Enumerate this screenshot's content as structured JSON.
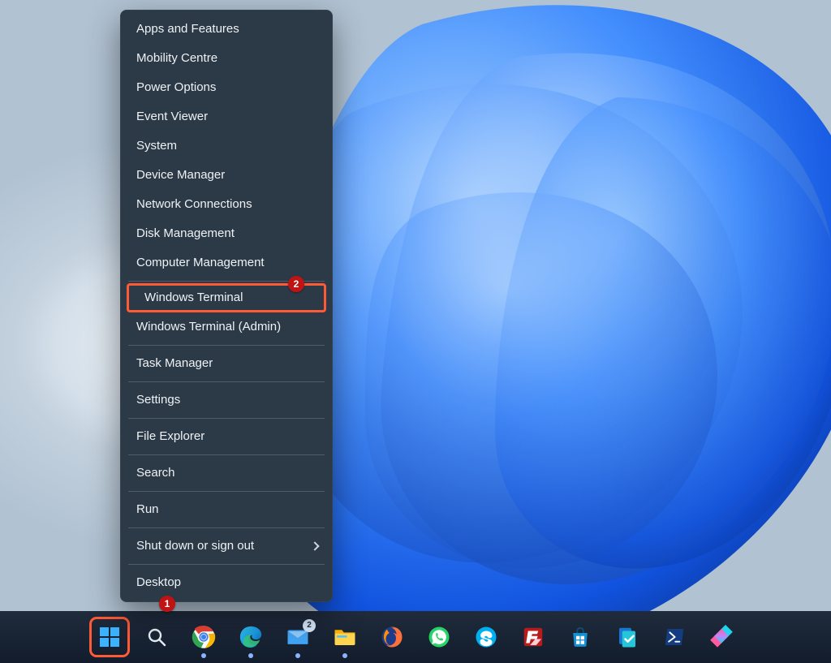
{
  "menu": {
    "groups": [
      [
        "Apps and Features",
        "Mobility Centre",
        "Power Options",
        "Event Viewer",
        "System",
        "Device Manager",
        "Network Connections",
        "Disk Management",
        "Computer Management"
      ],
      [
        "Windows Terminal",
        "Windows Terminal (Admin)"
      ],
      [
        "Task Manager"
      ],
      [
        "Settings"
      ],
      [
        "File Explorer"
      ],
      [
        "Search"
      ],
      [
        "Run"
      ],
      [
        "Shut down or sign out"
      ],
      [
        "Desktop"
      ]
    ],
    "submenu_items": [
      "Shut down or sign out"
    ],
    "highlighted_item": "Windows Terminal"
  },
  "annotations": {
    "badge1": "1",
    "badge2": "2"
  },
  "taskbar": {
    "items": [
      {
        "name": "start-button",
        "running": false
      },
      {
        "name": "search-icon",
        "running": false
      },
      {
        "name": "chrome-icon",
        "running": true
      },
      {
        "name": "edge-icon",
        "running": true
      },
      {
        "name": "mail-icon",
        "running": true
      },
      {
        "name": "file-explorer-icon",
        "running": true
      },
      {
        "name": "firefox-icon",
        "running": false
      },
      {
        "name": "whatsapp-icon",
        "running": false
      },
      {
        "name": "skype-icon",
        "running": false
      },
      {
        "name": "filezilla-icon",
        "running": false
      },
      {
        "name": "store-icon",
        "running": false
      },
      {
        "name": "todo-icon",
        "running": false
      },
      {
        "name": "powershell-icon",
        "running": false
      },
      {
        "name": "snagit-icon",
        "running": false
      }
    ],
    "mail_badge": "2"
  }
}
